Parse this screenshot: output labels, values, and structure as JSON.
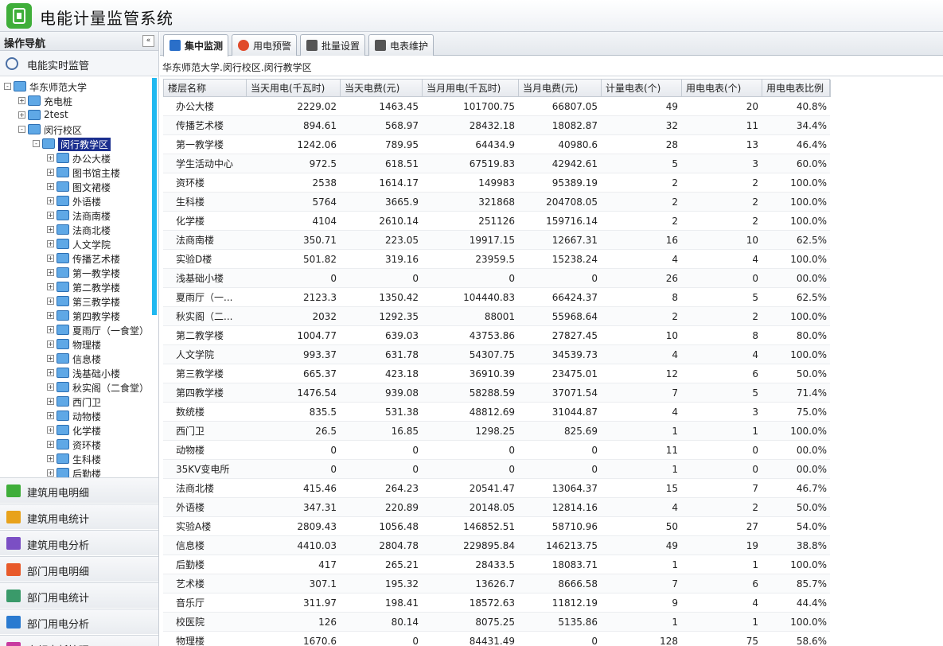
{
  "app": {
    "title": "电能计量监管系统"
  },
  "sidebar": {
    "header": "操作导航",
    "collapse_glyph": "«",
    "realtime_label": "电能实时监管",
    "tree": {
      "root": "华东师范大学",
      "level1": [
        "充电桩",
        "2test",
        "闵行校区"
      ],
      "selected": "闵行教学区",
      "buildings": [
        "办公大楼",
        "图书馆主楼",
        "图文裙楼",
        "外语楼",
        "法商南楼",
        "法商北楼",
        "人文学院",
        "传播艺术楼",
        "第一教学楼",
        "第二教学楼",
        "第三教学楼",
        "第四教学楼",
        "夏雨厅（一食堂）",
        "物理楼",
        "信息楼",
        "浅基础小楼",
        "秋实阁（二食堂）",
        "西门卫",
        "动物楼",
        "化学楼",
        "资环楼",
        "生科楼",
        "后勤楼"
      ]
    },
    "accordion": [
      "建筑用电明细",
      "建筑用电统计",
      "建筑用电分析",
      "部门用电明细",
      "部门用电统计",
      "部门用电分析",
      "定额电耗管理"
    ]
  },
  "tabs": [
    "集中监测",
    "用电预警",
    "批量设置",
    "电表维护"
  ],
  "breadcrumb": "华东师范大学.闵行校区.闵行教学区",
  "table": {
    "headers": [
      "楼层名称",
      "当天用电(千瓦时)",
      "当天电费(元)",
      "当月用电(千瓦时)",
      "当月电费(元)",
      "计量电表(个)",
      "用电电表(个)",
      "用电电表比例"
    ],
    "rows": [
      [
        "办公大楼",
        "2229.02",
        "1463.45",
        "101700.75",
        "66807.05",
        "49",
        "20",
        "40.8%"
      ],
      [
        "传播艺术楼",
        "894.61",
        "568.97",
        "28432.18",
        "18082.87",
        "32",
        "11",
        "34.4%"
      ],
      [
        "第一教学楼",
        "1242.06",
        "789.95",
        "64434.9",
        "40980.6",
        "28",
        "13",
        "46.4%"
      ],
      [
        "学生活动中心",
        "972.5",
        "618.51",
        "67519.83",
        "42942.61",
        "5",
        "3",
        "60.0%"
      ],
      [
        "资环楼",
        "2538",
        "1614.17",
        "149983",
        "95389.19",
        "2",
        "2",
        "100.0%"
      ],
      [
        "生科楼",
        "5764",
        "3665.9",
        "321868",
        "204708.05",
        "2",
        "2",
        "100.0%"
      ],
      [
        "化学楼",
        "4104",
        "2610.14",
        "251126",
        "159716.14",
        "2",
        "2",
        "100.0%"
      ],
      [
        "法商南楼",
        "350.71",
        "223.05",
        "19917.15",
        "12667.31",
        "16",
        "10",
        "62.5%"
      ],
      [
        "实验D楼",
        "501.82",
        "319.16",
        "23959.5",
        "15238.24",
        "4",
        "4",
        "100.0%"
      ],
      [
        "浅基础小楼",
        "0",
        "0",
        "0",
        "0",
        "26",
        "0",
        "00.0%"
      ],
      [
        "夏雨厅（一...",
        "2123.3",
        "1350.42",
        "104440.83",
        "66424.37",
        "8",
        "5",
        "62.5%"
      ],
      [
        "秋实阁（二...",
        "2032",
        "1292.35",
        "88001",
        "55968.64",
        "2",
        "2",
        "100.0%"
      ],
      [
        "第二教学楼",
        "1004.77",
        "639.03",
        "43753.86",
        "27827.45",
        "10",
        "8",
        "80.0%"
      ],
      [
        "人文学院",
        "993.37",
        "631.78",
        "54307.75",
        "34539.73",
        "4",
        "4",
        "100.0%"
      ],
      [
        "第三教学楼",
        "665.37",
        "423.18",
        "36910.39",
        "23475.01",
        "12",
        "6",
        "50.0%"
      ],
      [
        "第四教学楼",
        "1476.54",
        "939.08",
        "58288.59",
        "37071.54",
        "7",
        "5",
        "71.4%"
      ],
      [
        "数统楼",
        "835.5",
        "531.38",
        "48812.69",
        "31044.87",
        "4",
        "3",
        "75.0%"
      ],
      [
        "西门卫",
        "26.5",
        "16.85",
        "1298.25",
        "825.69",
        "1",
        "1",
        "100.0%"
      ],
      [
        "动物楼",
        "0",
        "0",
        "0",
        "0",
        "11",
        "0",
        "00.0%"
      ],
      [
        "35KV变电所",
        "0",
        "0",
        "0",
        "0",
        "1",
        "0",
        "00.0%"
      ],
      [
        "法商北楼",
        "415.46",
        "264.23",
        "20541.47",
        "13064.37",
        "15",
        "7",
        "46.7%"
      ],
      [
        "外语楼",
        "347.31",
        "220.89",
        "20148.05",
        "12814.16",
        "4",
        "2",
        "50.0%"
      ],
      [
        "实验A楼",
        "2809.43",
        "1056.48",
        "146852.51",
        "58710.96",
        "50",
        "27",
        "54.0%"
      ],
      [
        "信息楼",
        "4410.03",
        "2804.78",
        "229895.84",
        "146213.75",
        "49",
        "19",
        "38.8%"
      ],
      [
        "后勤楼",
        "417",
        "265.21",
        "28433.5",
        "18083.71",
        "1",
        "1",
        "100.0%"
      ],
      [
        "艺术楼",
        "307.1",
        "195.32",
        "13626.7",
        "8666.58",
        "7",
        "6",
        "85.7%"
      ],
      [
        "音乐厅",
        "311.97",
        "198.41",
        "18572.63",
        "11812.19",
        "9",
        "4",
        "44.4%"
      ],
      [
        "校医院",
        "126",
        "80.14",
        "8075.25",
        "5135.86",
        "1",
        "1",
        "100.0%"
      ],
      [
        "物理楼",
        "1670.6",
        "0",
        "84431.49",
        "0",
        "128",
        "75",
        "58.6%"
      ]
    ]
  }
}
